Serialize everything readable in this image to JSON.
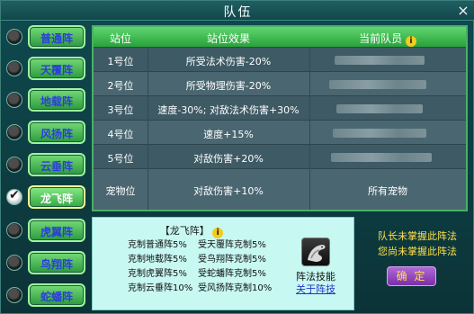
{
  "window": {
    "title": "队伍",
    "close_label": "×"
  },
  "formations": [
    {
      "label": "普通阵",
      "checked": false
    },
    {
      "label": "天覆阵",
      "checked": false
    },
    {
      "label": "地载阵",
      "checked": false
    },
    {
      "label": "风扬阵",
      "checked": false
    },
    {
      "label": "云垂阵",
      "checked": false
    },
    {
      "label": "龙飞阵",
      "checked": true
    },
    {
      "label": "虎翼阵",
      "checked": false
    },
    {
      "label": "鸟翔阵",
      "checked": false
    },
    {
      "label": "蛇蟠阵",
      "checked": false
    }
  ],
  "table": {
    "headers": {
      "position": "站位",
      "effect": "站位效果",
      "member": "当前队员"
    },
    "info_icon": "i",
    "rows": [
      {
        "position": "1号位",
        "effect": "所受法术伤害-20%",
        "member": ""
      },
      {
        "position": "2号位",
        "effect": "所受物理伤害-20%",
        "member": ""
      },
      {
        "position": "3号位",
        "effect": "速度-30%; 对敌法术伤害+30%",
        "member": ""
      },
      {
        "position": "4号位",
        "effect": "速度+15%",
        "member": ""
      },
      {
        "position": "5号位",
        "effect": "对敌伤害+20%",
        "member": ""
      },
      {
        "position": "宠物位",
        "effect": "对敌伤害+10%",
        "member": "所有宠物"
      }
    ]
  },
  "formation_info": {
    "title": "【龙飞阵】",
    "info_icon": "i",
    "restraints": [
      [
        "克制普通阵5%",
        "受天覆阵克制5%"
      ],
      [
        "克制地载阵5%",
        "受鸟翔阵克制5%"
      ],
      [
        "克制虎翼阵5%",
        "受蛇蟠阵克制5%"
      ],
      [
        "克制云垂阵10%",
        "受风扬阵克制10%"
      ]
    ],
    "skill_label": "阵法技能",
    "skill_link": "关于阵技",
    "skill_icon": "dragon-icon"
  },
  "right_panel": {
    "line1": "队长未掌握此阵法",
    "line2": "您尚未掌握此阵法",
    "confirm_label": "确 定"
  },
  "colors": {
    "accent_green": "#3fb84f",
    "label_blue": "#2a40d8",
    "warning_yellow": "#ffe04a",
    "confirm_purple": "#8a3cbc"
  }
}
